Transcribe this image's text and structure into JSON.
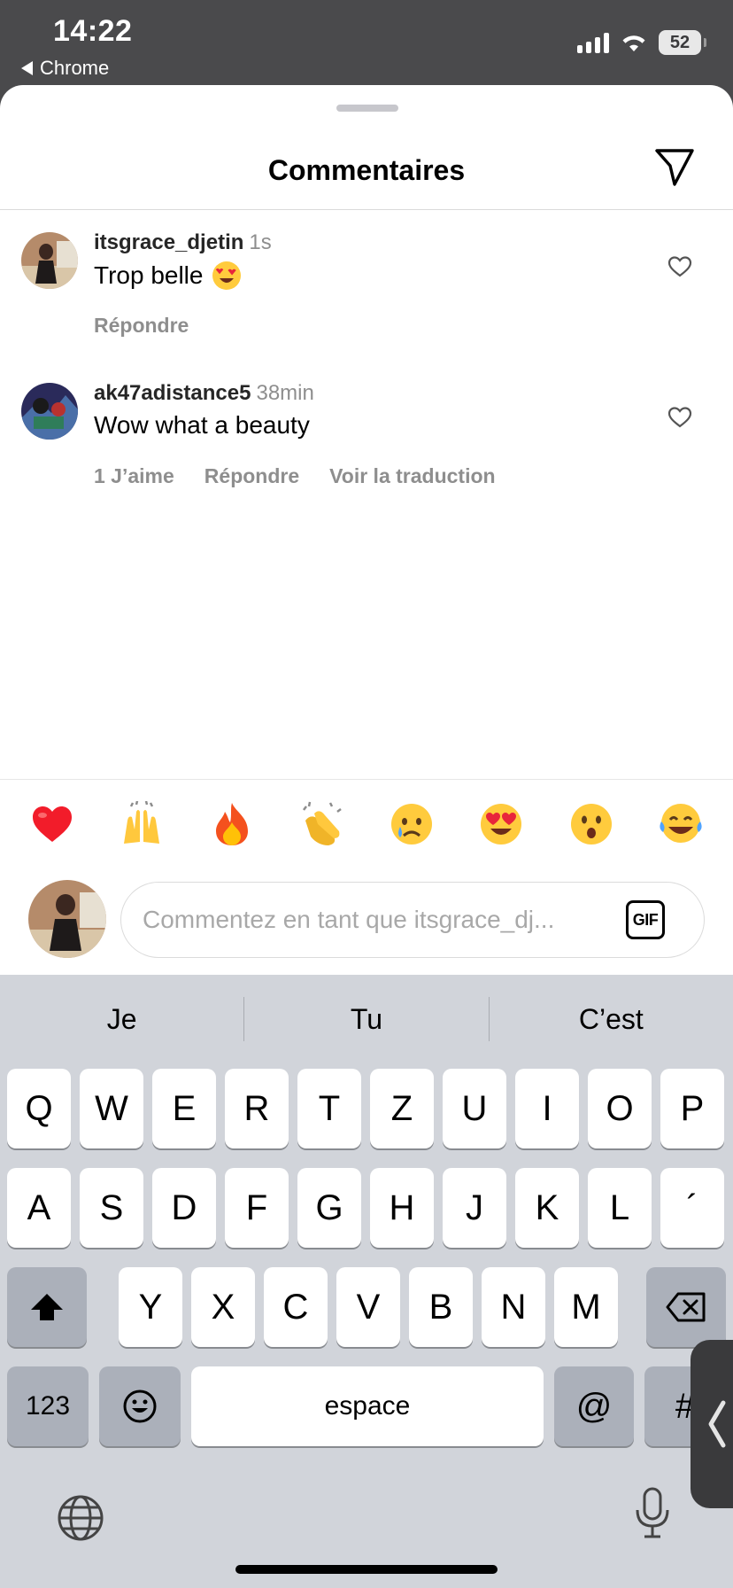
{
  "status_bar": {
    "time": "14:22",
    "back_label": "Chrome",
    "battery": "52"
  },
  "sheet": {
    "title": "Commentaires"
  },
  "comments": [
    {
      "username": "itsgrace_djetin",
      "time": "1s",
      "text": "Trop belle",
      "emoji": "heart-eyes",
      "actions": [
        "Répondre"
      ]
    },
    {
      "username": "ak47adistance5",
      "time": "38min",
      "text": "Wow what a beauty",
      "actions": [
        "1 J’aime",
        "Répondre",
        "Voir la traduction"
      ]
    }
  ],
  "reactions": [
    "red-heart",
    "raising-hands",
    "fire",
    "clapping-hands",
    "crying-face",
    "heart-eyes",
    "astonished-face",
    "tears-of-joy"
  ],
  "composer": {
    "placeholder": "Commentez en tant que itsgrace_dj...",
    "gif_label": "GIF"
  },
  "keyboard": {
    "suggestions": [
      "Je",
      "Tu",
      "C’est"
    ],
    "row1": [
      "Q",
      "W",
      "E",
      "R",
      "T",
      "Z",
      "U",
      "I",
      "O",
      "P"
    ],
    "row2": [
      "A",
      "S",
      "D",
      "F",
      "G",
      "H",
      "J",
      "K",
      "L",
      "´"
    ],
    "row3": [
      "Y",
      "X",
      "C",
      "V",
      "B",
      "N",
      "M"
    ],
    "numbers_label": "123",
    "space_label": "espace",
    "at_label": "@",
    "hash_label": "#"
  }
}
